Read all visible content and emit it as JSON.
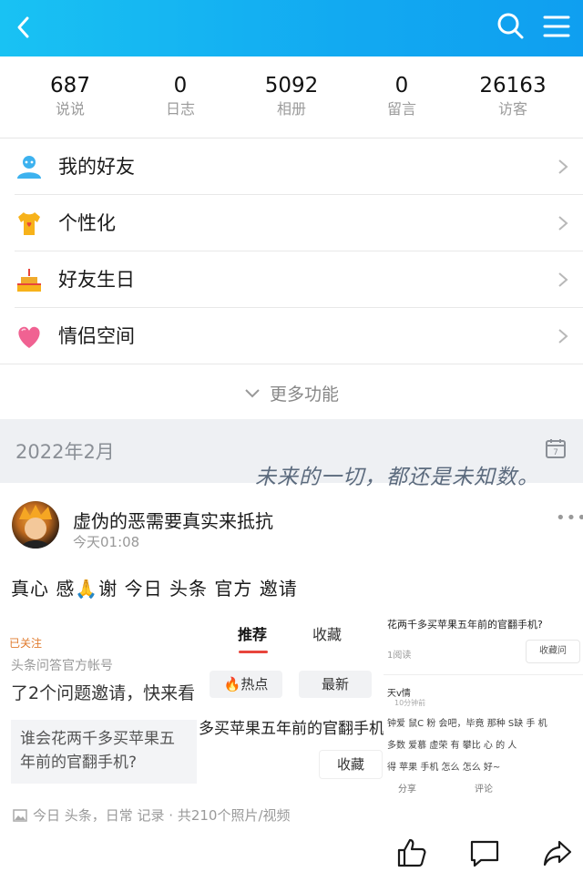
{
  "header": {
    "back_icon": "chevron-left-icon",
    "search_icon": "search-icon",
    "menu_icon": "menu-icon",
    "colors": {
      "bar_start": "#19c2f3",
      "bar_end": "#0f9ff0"
    }
  },
  "stats": [
    {
      "value": "687",
      "label": "说说"
    },
    {
      "value": "0",
      "label": "日志"
    },
    {
      "value": "5092",
      "label": "相册"
    },
    {
      "value": "0",
      "label": "留言"
    },
    {
      "value": "26163",
      "label": "访客"
    }
  ],
  "menu": {
    "items": [
      {
        "label": "我的好友",
        "icon": "friends-icon"
      },
      {
        "label": "个性化",
        "icon": "tshirt-icon"
      },
      {
        "label": "好友生日",
        "icon": "birthday-cake-icon"
      },
      {
        "label": "情侣空间",
        "icon": "heart-icon"
      }
    ],
    "more_label": "更多功能"
  },
  "timeline": {
    "month": "2022年2月",
    "quote": "未来的一切，都还是未知数。"
  },
  "post": {
    "author": "虚伪的恶需要真实来抵抗",
    "time": "今天01:08",
    "text": "真心 感🙏谢 今日 头条 官方 邀请",
    "images": {
      "img1": {
        "followed": "已关注",
        "account": "头条问答官方帐号",
        "invite": "了2个问题邀请，快来看",
        "question": "谁会花两千多买苹果五年前的官翻手机?"
      },
      "img2": {
        "tab_recommend": "推荐",
        "tab_collect": "收藏",
        "hot": "热点",
        "latest": "最新",
        "question": "多买苹果五年前的官翻手机",
        "collect": "收藏"
      },
      "img3": {
        "title": "花两千多买苹果五年前的官翻手机?",
        "reads": "1阅读",
        "collect_btn": "收藏问",
        "user": "天v情",
        "user_time": "10分钟前",
        "comment_1": "钟爱 鼠C 粉 会吧，毕竟 那种 S缺 手 机",
        "comment_2": "多数 爱慕 虚荣 有 攀比 心 的 人",
        "comment_3": "得 苹果 手机 怎么 怎么 好~",
        "share": "分享",
        "comment": "评论"
      }
    },
    "album": "今日 头条，日常 记录 · 共210个照片/视频",
    "actions": [
      "like-icon",
      "comment-icon",
      "share-icon"
    ]
  }
}
